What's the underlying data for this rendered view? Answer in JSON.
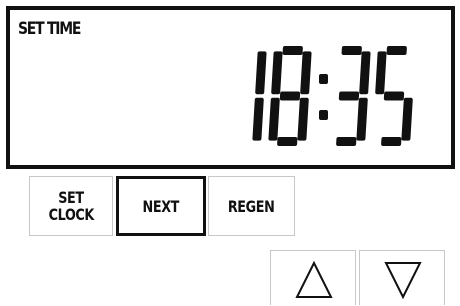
{
  "display": {
    "mode_label": "SET TIME",
    "time": "18:35"
  },
  "buttons": {
    "set_clock_line1": "SET",
    "set_clock_line2": "CLOCK",
    "next": "NEXT",
    "regen": "REGEN"
  },
  "arrows": {
    "up_icon": "triangle-up-outline-icon",
    "down_icon": "triangle-down-outline-icon"
  },
  "colors": {
    "segment": "#111111",
    "border": "#111111",
    "button_border": "#c8c8c8",
    "background": "#ffffff"
  }
}
